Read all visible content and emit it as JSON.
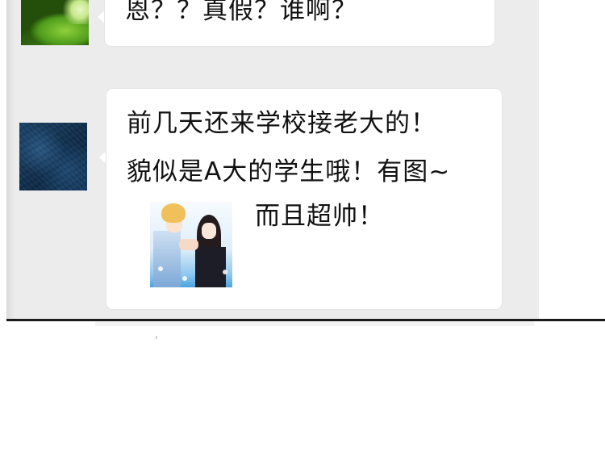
{
  "chat": {
    "messages": [
      {
        "sender_avatar": "green-leaf-avatar",
        "lines": [
          "恩？？真假？谁啊？"
        ]
      },
      {
        "sender_avatar": "blue-texture-avatar",
        "lines": [
          "前几天还来学校接老大的！",
          "貌似是A大的学生哦！有图~",
          "而且超帅！"
        ],
        "attachment": "anime-couple-sticker"
      }
    ]
  },
  "colors": {
    "panel_bg": "#ececec",
    "bubble_bg": "#ffffff",
    "text": "#111111",
    "divider": "#1a1a1a"
  }
}
